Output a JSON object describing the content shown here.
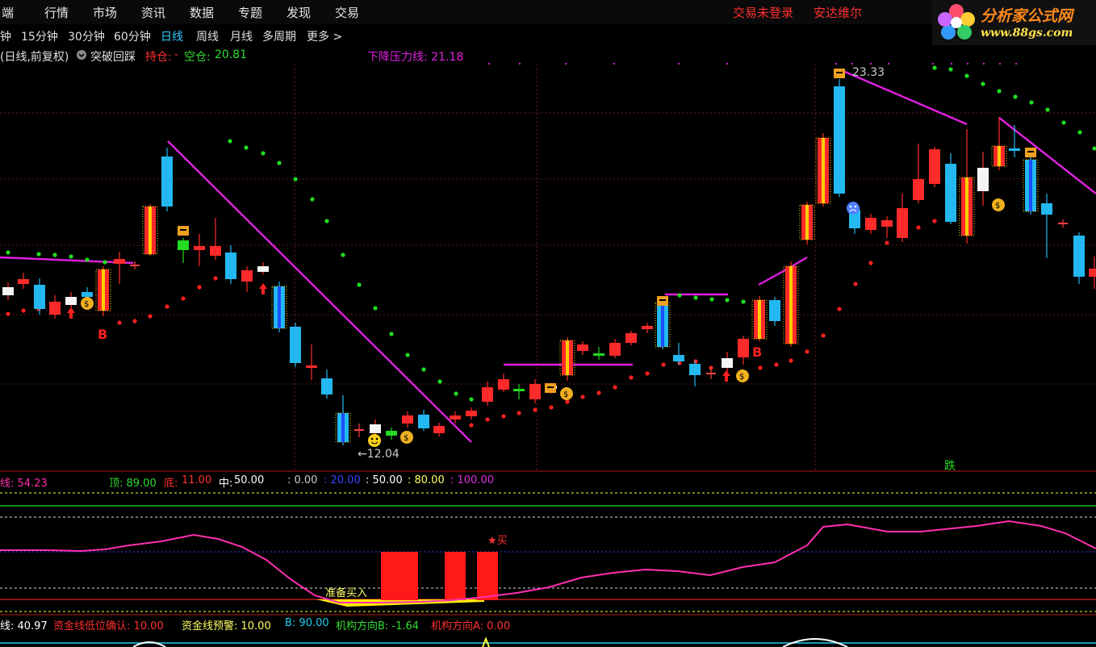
{
  "menu": {
    "items": [
      "端",
      "行情",
      "市场",
      "资讯",
      "数据",
      "专题",
      "发现",
      "交易"
    ],
    "right": [
      "交易未登录",
      "安达维尔"
    ]
  },
  "logo": {
    "name": "分析家公式网",
    "url": "www.88gs.com"
  },
  "timeframes": [
    "钟",
    "15分钟",
    "30分钟",
    "60分钟",
    "日线",
    "周线",
    "月线",
    "多周期",
    "更多 >"
  ],
  "active_timeframe": "日线",
  "info": {
    "mode": "(日线,前复权)",
    "formula": "突破回踩",
    "hold_label": "持仓:",
    "hold_value": "-",
    "empty_label": "空仓:",
    "empty_value": "20.81",
    "pressure": "下降压力线: 21.18"
  },
  "annotations": {
    "high": "23.33",
    "low": "←12.04",
    "b1": "B",
    "b2": "B",
    "fall": "跌"
  },
  "sub1": {
    "line": "线: 54.23",
    "top": "顶: 89.00",
    "bottom_label": "底:",
    "bottom_value": "11.00",
    "mid_label": "中:",
    "mid_value": "50.00",
    "l0": ": 0.00",
    "l20": ": 20.00",
    "l50": ": 50.00",
    "l80": ": 80.00",
    "l100": ": 100.00",
    "prepare": "准备买入",
    "buy": "★买"
  },
  "sub2": {
    "line": "线: 40.97",
    "low_confirm": "资金线低位确认: 10.00",
    "warn": "资金线预警: 10.00",
    "b": "B: 90.00",
    "dir_b": "机构方向B: -1.64",
    "dir_a": "机构方向A: 0.00"
  },
  "colors": {
    "up": "#ff2a2a",
    "down": "#23b8f0",
    "magenta": "#e020e0",
    "green_dot": "#22dd22",
    "red_dot": "#ff2020",
    "kdj_line": "#ff2fb0"
  }
}
